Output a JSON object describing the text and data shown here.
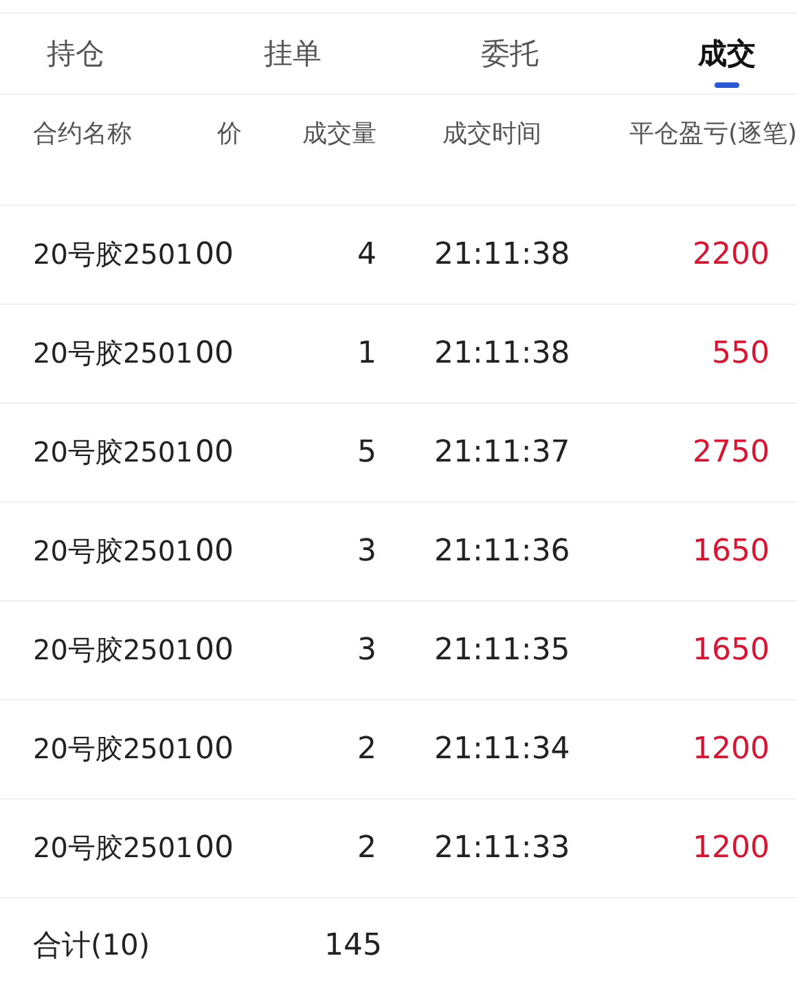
{
  "tabs": [
    {
      "label": "持仓",
      "selected": false
    },
    {
      "label": "挂单",
      "selected": false
    },
    {
      "label": "委托",
      "selected": false
    },
    {
      "label": "成交",
      "selected": true
    }
  ],
  "table": {
    "columns": [
      "合约名称",
      "价",
      "成交量",
      "成交时间",
      "平仓盈亏(逐笔)"
    ],
    "rows": [
      {
        "name": "20号胶2501",
        "column_2": "00",
        "volume": "4",
        "time": "21:11:38",
        "pnl": "2200"
      },
      {
        "name": "20号胶2501",
        "column_2": "00",
        "volume": "1",
        "time": "21:11:38",
        "pnl": "550"
      },
      {
        "name": "20号胶2501",
        "column_2": "00",
        "volume": "5",
        "time": "21:11:37",
        "pnl": "2750"
      },
      {
        "name": "20号胶2501",
        "column_2": "00",
        "volume": "3",
        "time": "21:11:36",
        "pnl": "1650"
      },
      {
        "name": "20号胶2501",
        "column_2": "00",
        "volume": "3",
        "time": "21:11:35",
        "pnl": "1650"
      },
      {
        "name": "20号胶2501",
        "column_2": "00",
        "volume": "2",
        "time": "21:11:34",
        "pnl": "1200"
      },
      {
        "name": "20号胶2501",
        "column_2": "00",
        "volume": "2",
        "time": "21:11:33",
        "pnl": "1200"
      }
    ]
  },
  "total": {
    "label": "合计(10)",
    "volume": "145"
  }
}
